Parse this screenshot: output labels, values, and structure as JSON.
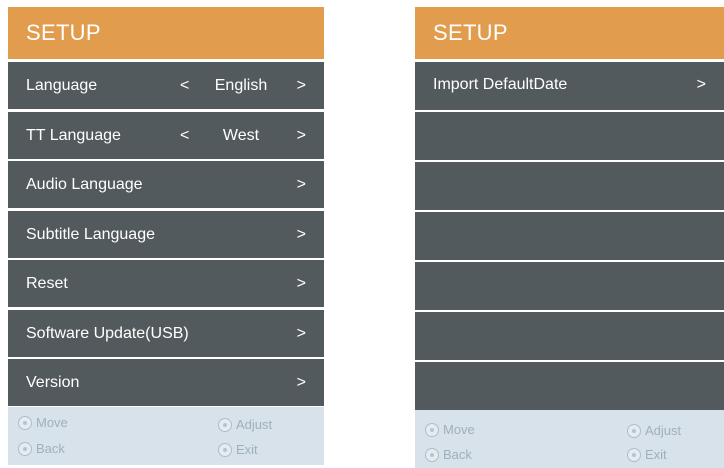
{
  "left_panel": {
    "title": "SETUP",
    "items": [
      {
        "label": "Language",
        "prev": "<",
        "value": "English",
        "next": ">"
      },
      {
        "label": "TT Language",
        "prev": "<",
        "value": "West",
        "next": ">"
      },
      {
        "label": "Audio Language",
        "next": ">"
      },
      {
        "label": "Subtitle Language",
        "next": ">"
      },
      {
        "label": "Reset",
        "next": ">"
      },
      {
        "label": "Software Update(USB)",
        "next": ">"
      },
      {
        "label": "Version",
        "next": ">"
      }
    ],
    "footer": {
      "move": "Move",
      "back": "Back",
      "adjust": "Adjust",
      "exit": "Exit"
    }
  },
  "right_panel": {
    "title": "SETUP",
    "items": [
      {
        "label": "Import DefaultDate",
        "next": ">"
      }
    ],
    "footer": {
      "move": "Move",
      "back": "Back",
      "adjust": "Adjust",
      "exit": "Exit"
    }
  }
}
